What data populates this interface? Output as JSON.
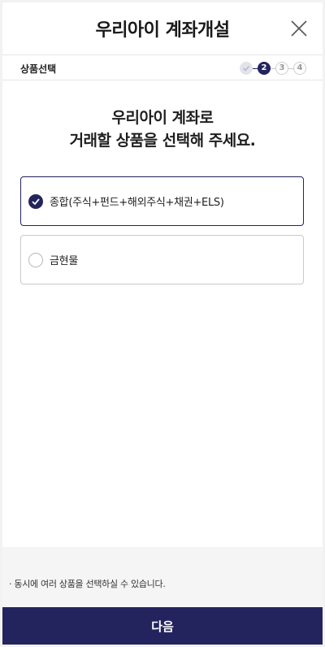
{
  "header": {
    "title": "우리아이 계좌개설",
    "close_icon": "close-icon"
  },
  "stepbar": {
    "label": "상품선택",
    "steps": [
      {
        "state": "done",
        "label": ""
      },
      {
        "state": "active",
        "label": "2"
      },
      {
        "state": "todo",
        "label": "3"
      },
      {
        "state": "todo",
        "label": "4"
      }
    ]
  },
  "headline": {
    "line1": "우리아이 계좌로",
    "line2": "거래할 상품을 선택해 주세요."
  },
  "options": [
    {
      "label": "종합(주식+펀드+해외주식+채권+ELS)",
      "selected": true
    },
    {
      "label": "금현물",
      "selected": false
    }
  ],
  "notice": {
    "text": "· 동시에 여러 상품을 선택하실 수 있습니다."
  },
  "footer": {
    "next_label": "다음"
  },
  "colors": {
    "primary": "#23245e",
    "border": "#c9c9c9",
    "notice_bg": "#f5f5f5"
  }
}
